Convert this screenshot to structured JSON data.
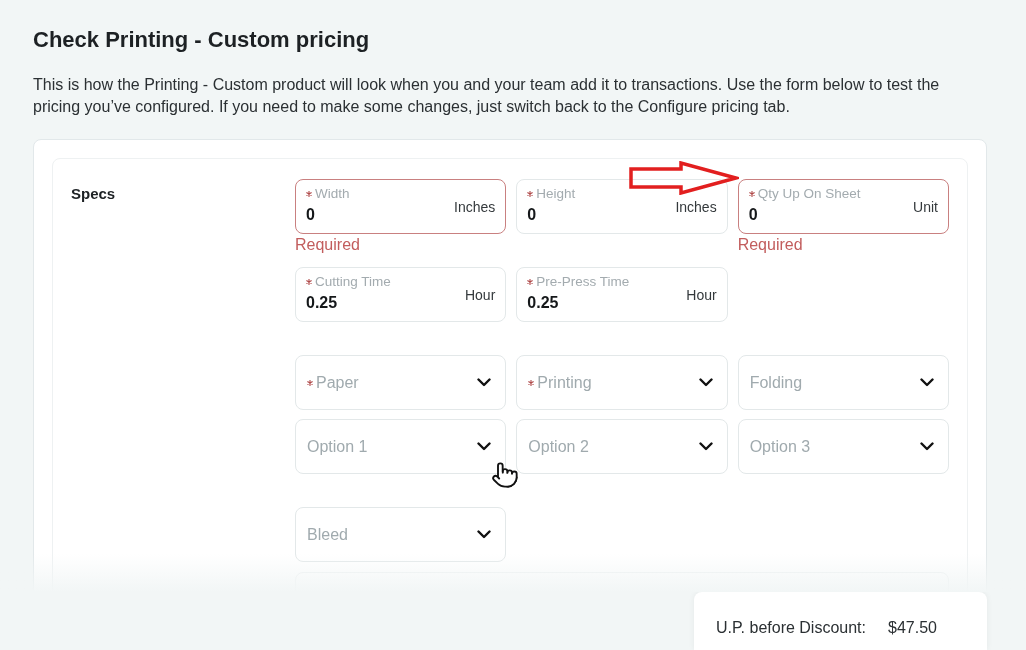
{
  "page": {
    "title": "Check Printing - Custom pricing",
    "description": "This is how the Printing - Custom product will look when you and your team add it to transactions. Use the form below to test the pricing you’ve configured. If you need to make some changes, just switch back to the Configure pricing tab."
  },
  "specs": {
    "label": "Specs",
    "inputs": [
      {
        "label": "Width",
        "required": true,
        "value": "0",
        "unit": "Inches",
        "invalid": true,
        "error": "Required"
      },
      {
        "label": "Height",
        "required": true,
        "value": "0",
        "unit": "Inches",
        "invalid": false
      },
      {
        "label": "Qty Up On Sheet",
        "required": true,
        "value": "0",
        "unit": "Unit",
        "invalid": true,
        "error": "Required"
      },
      {
        "label": "Cutting Time",
        "required": true,
        "value": "0.25",
        "unit": "Hour",
        "invalid": false
      },
      {
        "label": "Pre-Press Time",
        "required": true,
        "value": "0.25",
        "unit": "Hour",
        "invalid": false
      }
    ],
    "select_groups": [
      {
        "selects": [
          {
            "placeholder": "Paper",
            "required": true
          },
          {
            "placeholder": "Printing",
            "required": true
          },
          {
            "placeholder": "Folding",
            "required": false
          },
          {
            "placeholder": "Option 1",
            "required": false
          },
          {
            "placeholder": "Option 2",
            "required": false
          },
          {
            "placeholder": "Option 3",
            "required": false
          }
        ]
      },
      {
        "selects": [
          {
            "placeholder": "Bleed",
            "required": false
          }
        ]
      }
    ]
  },
  "summary": {
    "label": "U.P. before Discount:",
    "value": "$47.50"
  }
}
